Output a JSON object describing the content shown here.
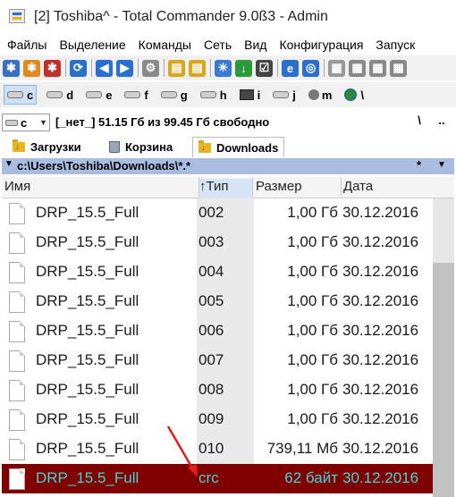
{
  "window": {
    "title": "[2] Toshiba^ - Total Commander 9.0ß3 - Admin"
  },
  "menu": [
    "Файлы",
    "Выделение",
    "Команды",
    "Сеть",
    "Вид",
    "Конфигурация",
    "Запуск"
  ],
  "toolbar": {
    "buttons": [
      {
        "name": "gear-blue-icon",
        "color": "#3a6fc4"
      },
      {
        "name": "gear-orange-icon",
        "color": "#e08a1e"
      },
      {
        "name": "gear-red-icon",
        "color": "#c0302a"
      },
      {
        "name": "refresh-icon",
        "color": "#2a70c8"
      },
      {
        "name": "back-arrow-icon",
        "color": "#2a6fd0"
      },
      {
        "name": "forward-arrow-icon",
        "color": "#2a6fd0"
      },
      {
        "name": "settings-icon",
        "color": "#8a8a8a"
      },
      {
        "name": "pack-icon",
        "color": "#d9a620"
      },
      {
        "name": "unpack-icon",
        "color": "#d9a620"
      },
      {
        "name": "find-icon",
        "color": "#3a7ad0"
      },
      {
        "name": "sort-az-icon",
        "color": "#2a9a3a"
      },
      {
        "name": "checklist-icon",
        "color": "#444444"
      },
      {
        "name": "browser-icon",
        "color": "#2a6fd0"
      },
      {
        "name": "network-icon",
        "color": "#2a6fd0"
      },
      {
        "name": "notepad-icon",
        "color": "#999999"
      },
      {
        "name": "view-icon",
        "color": "#888888"
      },
      {
        "name": "compare-icon",
        "color": "#888888"
      },
      {
        "name": "copy-names-icon",
        "color": "#888888"
      }
    ]
  },
  "drives": [
    {
      "letter": "c",
      "active": true,
      "icon": "hdd"
    },
    {
      "letter": "d",
      "icon": "hdd"
    },
    {
      "letter": "e",
      "icon": "hdd"
    },
    {
      "letter": "f",
      "icon": "hdd"
    },
    {
      "letter": "g",
      "icon": "hdd"
    },
    {
      "letter": "h",
      "icon": "hdd"
    },
    {
      "letter": "i",
      "icon": "monitor"
    },
    {
      "letter": "j",
      "icon": "hdd"
    },
    {
      "letter": "m",
      "icon": "person"
    },
    {
      "letter": "\\",
      "icon": "globe"
    }
  ],
  "infobar": {
    "drive": "c",
    "label": "[_нет_]",
    "free": "51.15 Гб из 99.45 Гб свободно",
    "root": "\\",
    "up": ".."
  },
  "tabs": [
    {
      "label": "Загрузки",
      "icon": "folder-download"
    },
    {
      "label": "Корзина",
      "icon": "trash"
    },
    {
      "label": "Downloads",
      "icon": "folder-download",
      "active": true
    }
  ],
  "path": {
    "text": "c:\\Users\\Toshiba\\Downloads\\*.*",
    "mask": "*",
    "dropdown": "▼"
  },
  "columns": {
    "name": "Имя",
    "ext": "Тип",
    "sort_arrow": "↑",
    "size": "Размер",
    "date": "Дата"
  },
  "files": [
    {
      "name": "DRP_15.5_Full",
      "ext": "002",
      "size": "1,00 Гб",
      "date": "30.12.2016"
    },
    {
      "name": "DRP_15.5_Full",
      "ext": "003",
      "size": "1,00 Гб",
      "date": "30.12.2016"
    },
    {
      "name": "DRP_15.5_Full",
      "ext": "004",
      "size": "1,00 Гб",
      "date": "30.12.2016"
    },
    {
      "name": "DRP_15.5_Full",
      "ext": "005",
      "size": "1,00 Гб",
      "date": "30.12.2016"
    },
    {
      "name": "DRP_15.5_Full",
      "ext": "006",
      "size": "1,00 Гб",
      "date": "30.12.2016"
    },
    {
      "name": "DRP_15.5_Full",
      "ext": "007",
      "size": "1,00 Гб",
      "date": "30.12.2016"
    },
    {
      "name": "DRP_15.5_Full",
      "ext": "008",
      "size": "1,00 Гб",
      "date": "30.12.2016"
    },
    {
      "name": "DRP_15.5_Full",
      "ext": "009",
      "size": "1,00 Гб",
      "date": "30.12.2016"
    },
    {
      "name": "DRP_15.5_Full",
      "ext": "010",
      "size": "739,11 Мб",
      "date": "30.12.2016"
    },
    {
      "name": "DRP_15.5_Full",
      "ext": "crc",
      "size": "62 байт",
      "date": "30.12.2016",
      "selected": true
    }
  ],
  "colors": {
    "selection_bg": "#800000",
    "selection_text": "#3fd6d9",
    "path_bar": "#a8bde0",
    "annotation_arrow": "#e02020"
  }
}
